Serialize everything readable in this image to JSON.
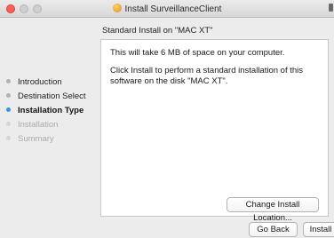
{
  "window": {
    "title": "Install SurveillanceClient"
  },
  "header": {
    "subtitle": "Standard Install on \"MAC XT\""
  },
  "sidebar": {
    "steps": [
      {
        "label": "Introduction",
        "state": "done"
      },
      {
        "label": "Destination Select",
        "state": "done"
      },
      {
        "label": "Installation Type",
        "state": "current"
      },
      {
        "label": "Installation",
        "state": "future"
      },
      {
        "label": "Summary",
        "state": "future"
      }
    ]
  },
  "main": {
    "message_size": "This will take 6 MB of space on your computer.",
    "message_install": "Click Install to perform a standard installation of this software on the disk \"MAC XT\".",
    "change_location_label": "Change Install Location..."
  },
  "footer": {
    "back_label": "Go Back",
    "install_label": "Install"
  },
  "colors": {
    "accent": "#3b8fe8",
    "close_button": "#fc5f57"
  },
  "icons": {
    "title_icon": "installer-package-icon",
    "corner_icon": "lock-icon"
  }
}
